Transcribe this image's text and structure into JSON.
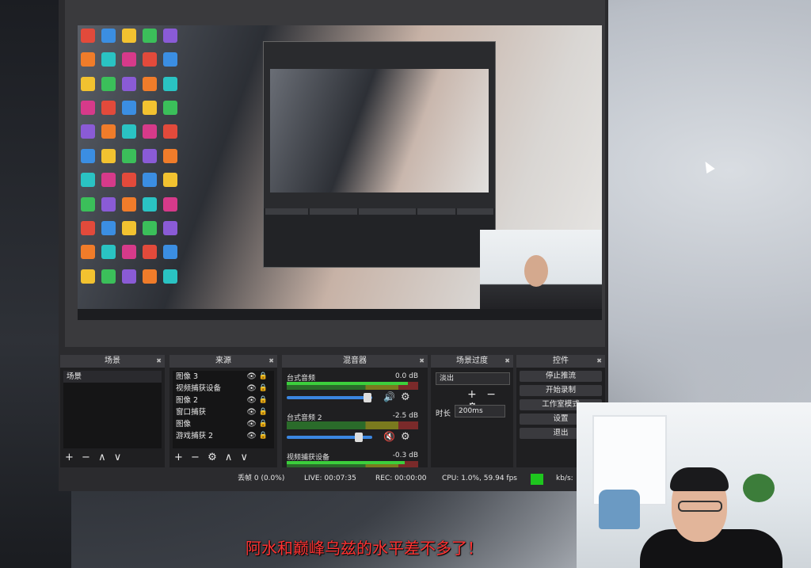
{
  "docks": {
    "scenes": {
      "title": "场景",
      "items": [
        "场景"
      ]
    },
    "sources": {
      "title": "来源",
      "items": [
        "图像 3",
        "视频捕获设备",
        "图像 2",
        "窗口捕获",
        "图像",
        "游戏捕获 2"
      ]
    },
    "mixer": {
      "title": "混音器",
      "tracks": [
        {
          "name": "台式音频",
          "db": "0.0 dB",
          "level": 0.92,
          "volume": 0.9,
          "muted": false
        },
        {
          "name": "台式音频 2",
          "db": "-2.5 dB",
          "level": 0.0,
          "volume": 0.8,
          "muted": true
        },
        {
          "name": "视频捕获设备",
          "db": "-0.3 dB",
          "level": 0.9,
          "volume": 0.9,
          "muted": false
        }
      ]
    },
    "transitions": {
      "title": "场景过度",
      "selected": "淡出",
      "duration_label": "时长",
      "duration": "200ms"
    },
    "controls": {
      "title": "控件",
      "buttons": [
        "停止推流",
        "开始录制",
        "工作室模式",
        "设置",
        "退出"
      ]
    }
  },
  "status": {
    "dropped": "丢帧 0 (0.0%)",
    "live": "LIVE: 00:07:35",
    "rec": "REC: 00:00:00",
    "cpu": "CPU: 1.0%, 59.94 fps",
    "kbs": "kb/s:",
    "indicator_color": "#1ec51e"
  },
  "icons": {
    "add": "+",
    "remove": "−",
    "up": "∧",
    "down": "∨",
    "gear": "⚙",
    "speaker": "🔊",
    "muted_speaker": "🔇",
    "eye": "👁",
    "lock": "🔒",
    "close": "✖"
  },
  "subtitle": "阿水和巅峰乌兹的水平差不多了！"
}
